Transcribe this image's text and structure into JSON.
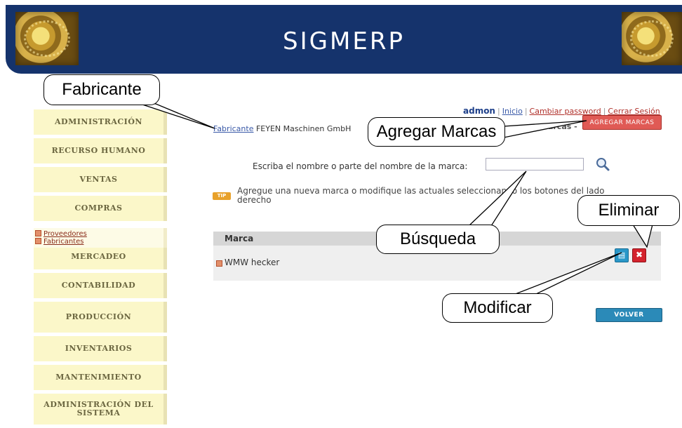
{
  "header": {
    "title": "SIGMERP"
  },
  "userbar": {
    "username": "admon",
    "links": [
      "Inicio",
      "Cambiar password",
      "Cerrar Sesión"
    ]
  },
  "sidebar": {
    "items": [
      {
        "label": "Administración"
      },
      {
        "label": "Recurso Humano"
      },
      {
        "label": "Ventas"
      },
      {
        "label": "Compras"
      },
      {
        "label": "Mercadeo"
      },
      {
        "label": "Contabilidad"
      },
      {
        "label": "Producción"
      },
      {
        "label": "Inventarios"
      },
      {
        "label": "mantenimiento"
      },
      {
        "label": "Administración Del Sistema"
      }
    ],
    "submenu": [
      "Proveedores",
      "Fabricantes"
    ]
  },
  "main": {
    "breadcrumb_link": "Fabricante",
    "breadcrumb_value": "FEYEN Maschinen GmbH",
    "marcas_label": "Marcas -",
    "add_button": "Agregar Marcas",
    "search_label": "Escriba el nombre o parte del nombre de la marca:",
    "search_value": "",
    "tip_badge": "TIP",
    "tip_text": "Agregue una nueva marca o modifique las actuales seleccionando los botones del lado derecho",
    "table": {
      "header": "Marca",
      "rows": [
        {
          "name": "WMW hecker"
        }
      ]
    },
    "back_button": "Volver"
  },
  "callouts": {
    "fabricante": "Fabricante",
    "agregar": "Agregar Marcas",
    "busqueda": "Búsqueda",
    "eliminar": "Eliminar",
    "modificar": "Modificar"
  },
  "colors": {
    "header_bg": "#15336c",
    "menu_bg": "#fbf7c9",
    "add_button": "#e05a55",
    "back_button": "#2b8ab8",
    "edit_button": "#2a97c8",
    "delete_button": "#d4232d"
  }
}
